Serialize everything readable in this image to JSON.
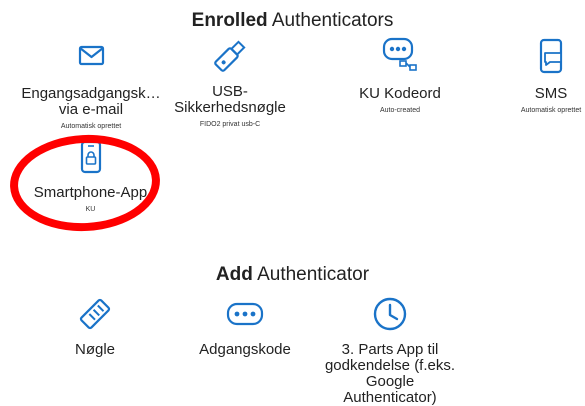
{
  "enrolled": {
    "title_bold": "Enrolled",
    "title_rest": " Authenticators",
    "items": [
      {
        "label": "Engangsadgangsk…\nvia e-mail",
        "sub": "Automatisk oprettet",
        "icon": "envelope-icon"
      },
      {
        "label": "USB-\nSikkerhedsnøgle",
        "sub": "FIDO2 privat usb-C",
        "icon": "usb-key-icon"
      },
      {
        "label": "KU Kodeord",
        "sub": "Auto-created",
        "icon": "password-dialog-icon"
      },
      {
        "label": "SMS",
        "sub": "Automatisk oprettet",
        "icon": "phone-message-icon"
      },
      {
        "label": "Smartphone-App",
        "sub": "KU",
        "icon": "phone-lock-icon"
      }
    ]
  },
  "add": {
    "title_bold": "Add",
    "title_rest": " Authenticator",
    "items": [
      {
        "label": "Nøgle",
        "icon": "security-key-icon"
      },
      {
        "label": "Adgangskode",
        "icon": "password-icon"
      },
      {
        "label": "3. Parts App til\ngodkendelse (f.eks.\nGoogle Authenticator)",
        "icon": "clock-icon"
      }
    ]
  },
  "colors": {
    "icon_blue": "#1a73c8",
    "highlight_red": "#ff0000",
    "text": "#222222"
  }
}
